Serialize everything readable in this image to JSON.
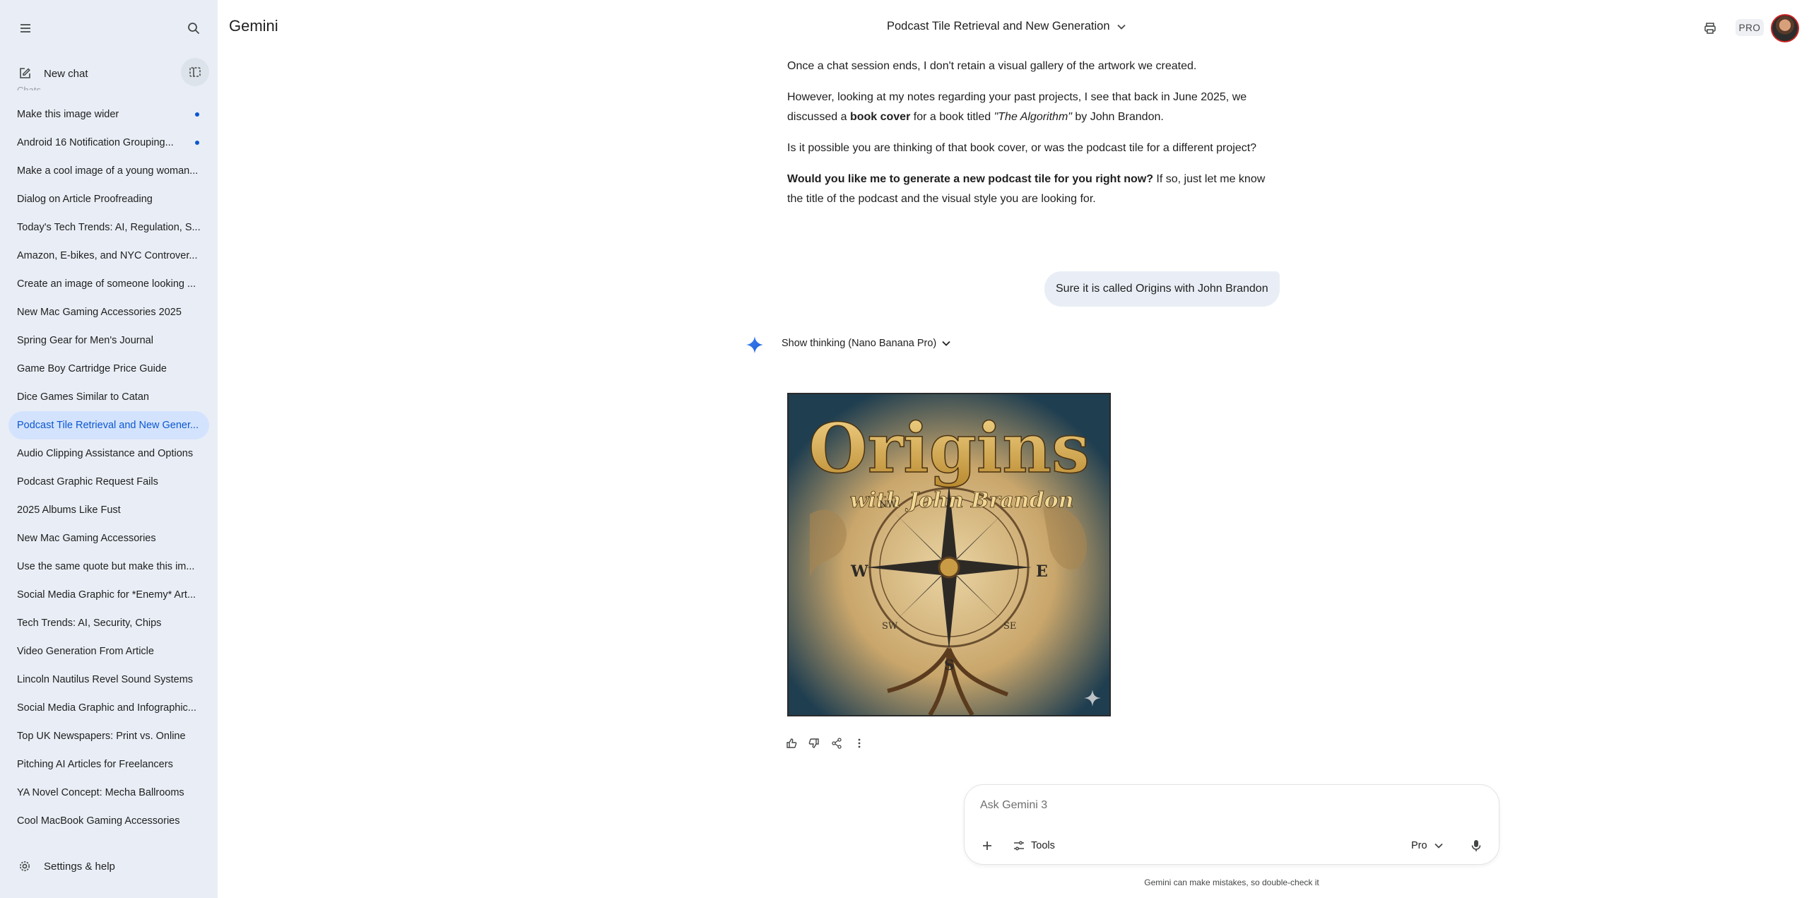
{
  "app": {
    "brand": "Gemini",
    "conversation_title": "Podcast Tile Retrieval and New Generation",
    "plan_badge": "PRO"
  },
  "sidebar": {
    "new_chat_label": "New chat",
    "section_label": "Chats",
    "items": [
      {
        "label": "Make this image wider",
        "unread": true
      },
      {
        "label": "Android 16 Notification Grouping...",
        "unread": true
      },
      {
        "label": "Make a cool image of a young woman...",
        "unread": false
      },
      {
        "label": "Dialog on Article Proofreading",
        "unread": false
      },
      {
        "label": "Today's Tech Trends: AI, Regulation, S...",
        "unread": false
      },
      {
        "label": "Amazon, E-bikes, and NYC Controver...",
        "unread": false
      },
      {
        "label": "Create an image of someone looking ...",
        "unread": false
      },
      {
        "label": "New Mac Gaming Accessories 2025",
        "unread": false
      },
      {
        "label": "Spring Gear for Men's Journal",
        "unread": false
      },
      {
        "label": "Game Boy Cartridge Price Guide",
        "unread": false
      },
      {
        "label": "Dice Games Similar to Catan",
        "unread": false
      },
      {
        "label": "Podcast Tile Retrieval and New Gener...",
        "unread": false,
        "active": true
      },
      {
        "label": "Audio Clipping Assistance and Options",
        "unread": false
      },
      {
        "label": "Podcast Graphic Request Fails",
        "unread": false
      },
      {
        "label": "2025 Albums Like Fust",
        "unread": false
      },
      {
        "label": "New Mac Gaming Accessories",
        "unread": false
      },
      {
        "label": "Use the same quote but make this im...",
        "unread": false
      },
      {
        "label": "Social Media Graphic for *Enemy* Art...",
        "unread": false
      },
      {
        "label": "Tech Trends: AI, Security, Chips",
        "unread": false
      },
      {
        "label": "Video Generation From Article",
        "unread": false
      },
      {
        "label": "Lincoln Nautilus Revel Sound Systems",
        "unread": false
      },
      {
        "label": "Social Media Graphic and Infographic...",
        "unread": false
      },
      {
        "label": "Top UK Newspapers: Print vs. Online",
        "unread": false
      },
      {
        "label": "Pitching AI Articles for Freelancers",
        "unread": false
      },
      {
        "label": "YA Novel Concept: Mecha Ballrooms",
        "unread": false
      },
      {
        "label": "Cool MacBook Gaming Accessories",
        "unread": false
      }
    ],
    "settings_label": "Settings & help"
  },
  "conversation": {
    "model_reply": {
      "p1": "Once a chat session ends, I don't retain a visual gallery of the artwork we created.",
      "p2_a": "However, looking at my notes regarding your past projects, I see that back in June 2025, we discussed a ",
      "p2_bold": "book cover",
      "p2_b": " for a book titled ",
      "p2_italic": "\"The Algorithm\"",
      "p2_c": " by John Brandon.",
      "p3": "Is it possible you are thinking of that book cover, or was the podcast tile for a different project?",
      "p4_bold": "Would you like me to generate a new podcast tile for you right now?",
      "p4_rest": " If so, just let me know the title of the podcast and the visual style you are looking for."
    },
    "user_message": "Sure it is called Origins with John Brandon",
    "thinking_label": "Show thinking (Nano Banana Pro)",
    "image": {
      "title": "Origins",
      "subtitle": "with John Brandon",
      "compass": [
        "W",
        "E",
        "S",
        "NW",
        "SW",
        "SE"
      ]
    }
  },
  "composer": {
    "placeholder": "Ask Gemini 3",
    "tools_label": "Tools",
    "model_label": "Pro",
    "disclaimer": "Gemini can make mistakes, so double-check it"
  }
}
